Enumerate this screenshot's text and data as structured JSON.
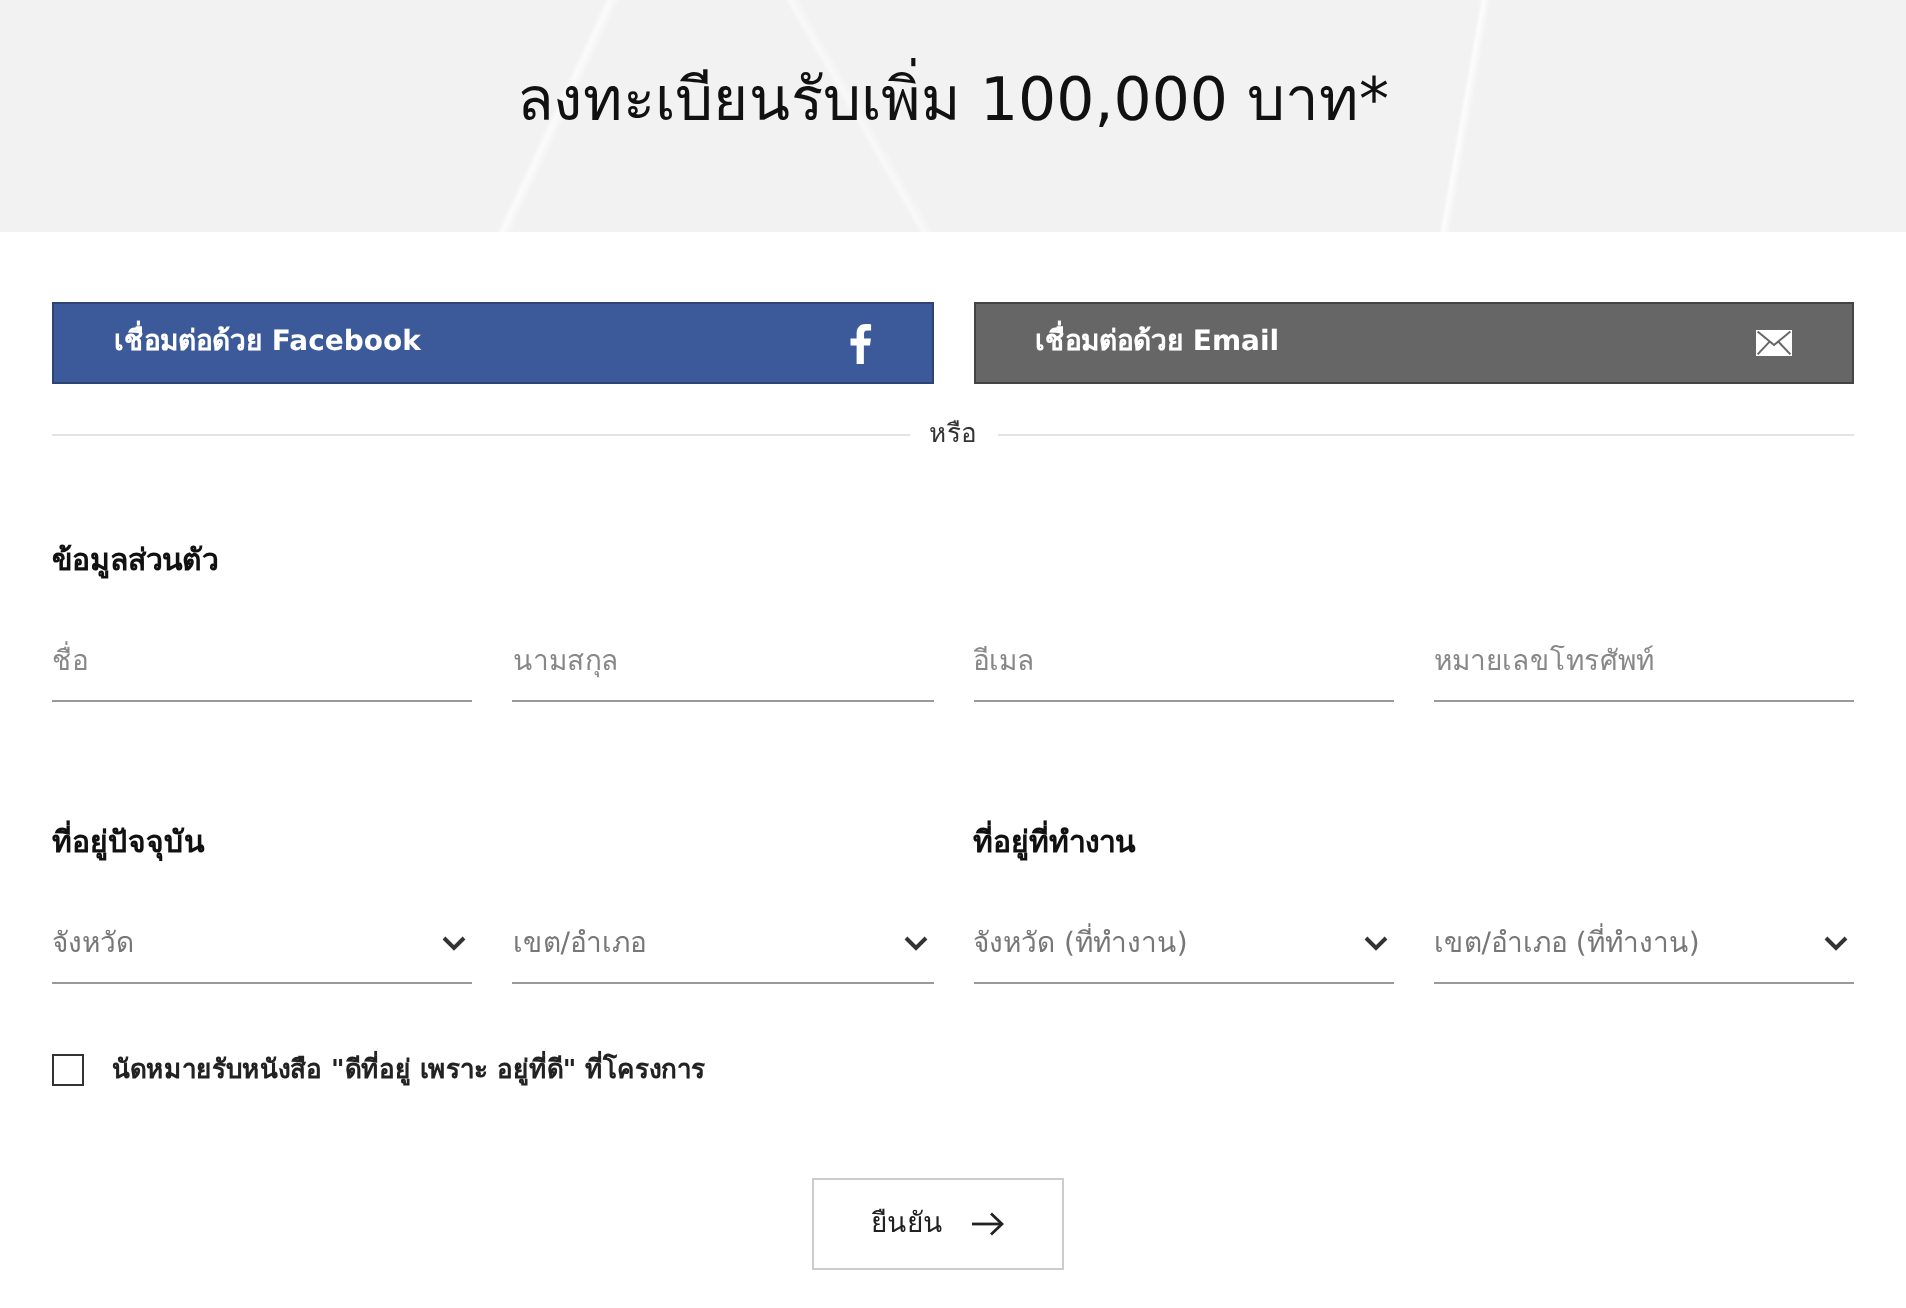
{
  "header": {
    "title": "ลงทะเบียนรับเพิ่ม 100,000 บาท*"
  },
  "social_buttons": [
    {
      "kind": "facebook",
      "label": "เชื่อมต่อด้วย Facebook"
    },
    {
      "kind": "email",
      "label": "เชื่อมต่อด้วย Email"
    }
  ],
  "divider": {
    "label": "หรือ"
  },
  "personal_info": {
    "title": "ข้อมูลส่วนตัว",
    "fields": [
      {
        "placeholder": "ชื่อ"
      },
      {
        "placeholder": "นามสกุล"
      },
      {
        "placeholder": "อีเมล"
      },
      {
        "placeholder": "หมายเลขโทรศัพท์"
      }
    ]
  },
  "address_groups": [
    {
      "title": "ที่อยู่ปัจจุบัน",
      "selects": [
        {
          "placeholder": "จังหวัด"
        },
        {
          "placeholder": "เขต/อำเภอ"
        }
      ]
    },
    {
      "title": "ที่อยู่ที่ทำงาน",
      "selects": [
        {
          "placeholder": "จังหวัด (ที่ทำงาน)"
        },
        {
          "placeholder": "เขต/อำเภอ (ที่ทำงาน)"
        }
      ]
    }
  ],
  "consent": {
    "label": "นัดหมายรับหนังสือ \"ดีที่อยู่ เพราะ อยู่ที่ดี\" ที่โครงการ",
    "checked": false
  },
  "submit": {
    "label": "ยืนยัน"
  }
}
